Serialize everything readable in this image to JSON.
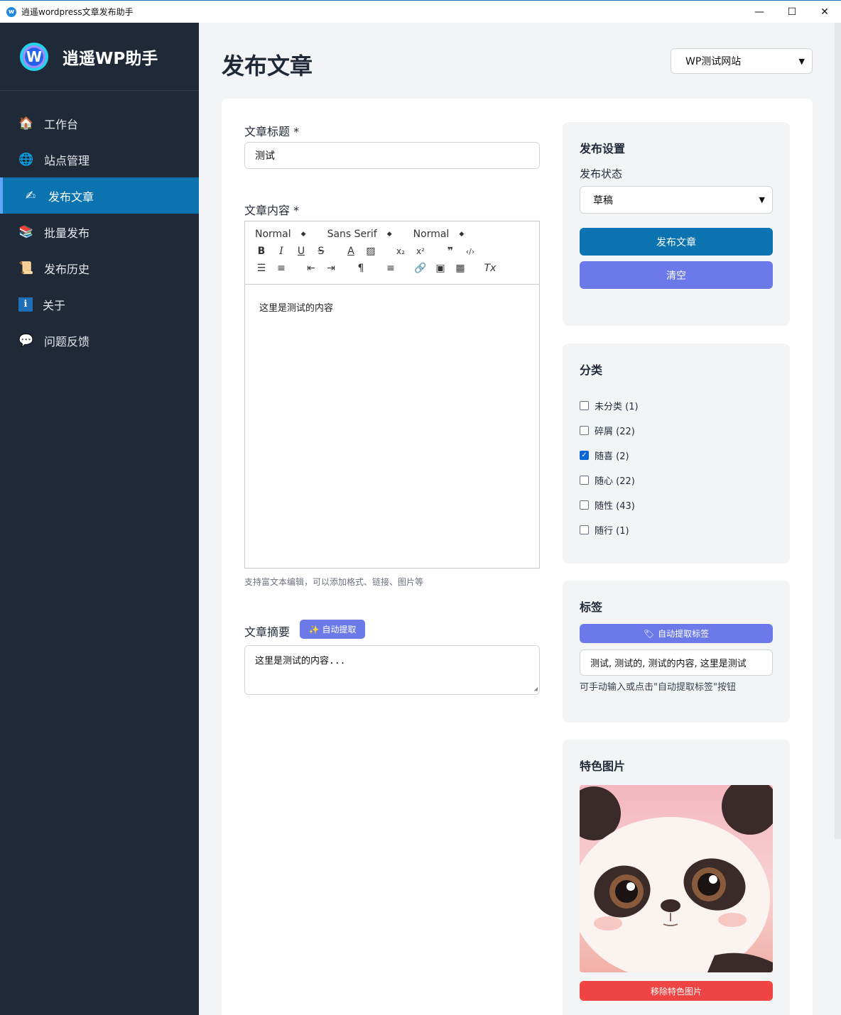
{
  "window": {
    "title": "逍遥wordpress文章发布助手",
    "controls": [
      "—",
      "☐",
      "✕"
    ]
  },
  "brand": {
    "name": "逍遥WP助手",
    "logo_letter": "W"
  },
  "nav": [
    {
      "label": "工作台",
      "icon": "🏠"
    },
    {
      "label": "站点管理",
      "icon": "🌐"
    },
    {
      "label": "发布文章",
      "icon": "✍"
    },
    {
      "label": "批量发布",
      "icon": "📚"
    },
    {
      "label": "发布历史",
      "icon": "📜"
    },
    {
      "label": "关于",
      "icon": "ℹ"
    },
    {
      "label": "问题反馈",
      "icon": "💬"
    }
  ],
  "page": {
    "title": "发布文章",
    "site_selected": "WP测试网站"
  },
  "form": {
    "title_label": "文章标题 *",
    "title_value": "测试",
    "content_label": "文章内容 *",
    "toolbar": {
      "header": "Normal",
      "font": "Sans Serif",
      "size": "Normal"
    },
    "content_value": "这里是测试的内容",
    "content_hint": "支持富文本编辑，可以添加格式、链接、图片等",
    "excerpt_label": "文章摘要",
    "auto_extract": "自动提取",
    "excerpt_value": "这里是测试的内容..."
  },
  "publish": {
    "title": "发布设置",
    "status_label": "发布状态",
    "status_value": "草稿",
    "publish_button": "发布文章",
    "clear_button": "清空"
  },
  "categories": {
    "title": "分类",
    "items": [
      {
        "label": "未分类 (1)",
        "checked": false
      },
      {
        "label": "碎屑 (22)",
        "checked": false
      },
      {
        "label": "随喜 (2)",
        "checked": true
      },
      {
        "label": "随心 (22)",
        "checked": false
      },
      {
        "label": "随性 (43)",
        "checked": false
      },
      {
        "label": "随行 (1)",
        "checked": false
      }
    ]
  },
  "tags": {
    "title": "标签",
    "auto_button": "自动提取标签",
    "value": "测试, 测试的, 测试的内容, 这里是测试",
    "hint": "可手动输入或点击\"自动提取标签\"按钮"
  },
  "featured": {
    "title": "特色图片",
    "remove_button": "移除特色图片"
  },
  "colors": {
    "sidebar": "#1f2937",
    "active_nav": "#0b74b0",
    "primary": "#0b74b0",
    "secondary": "#6b7ae8",
    "danger": "#ef4444"
  }
}
